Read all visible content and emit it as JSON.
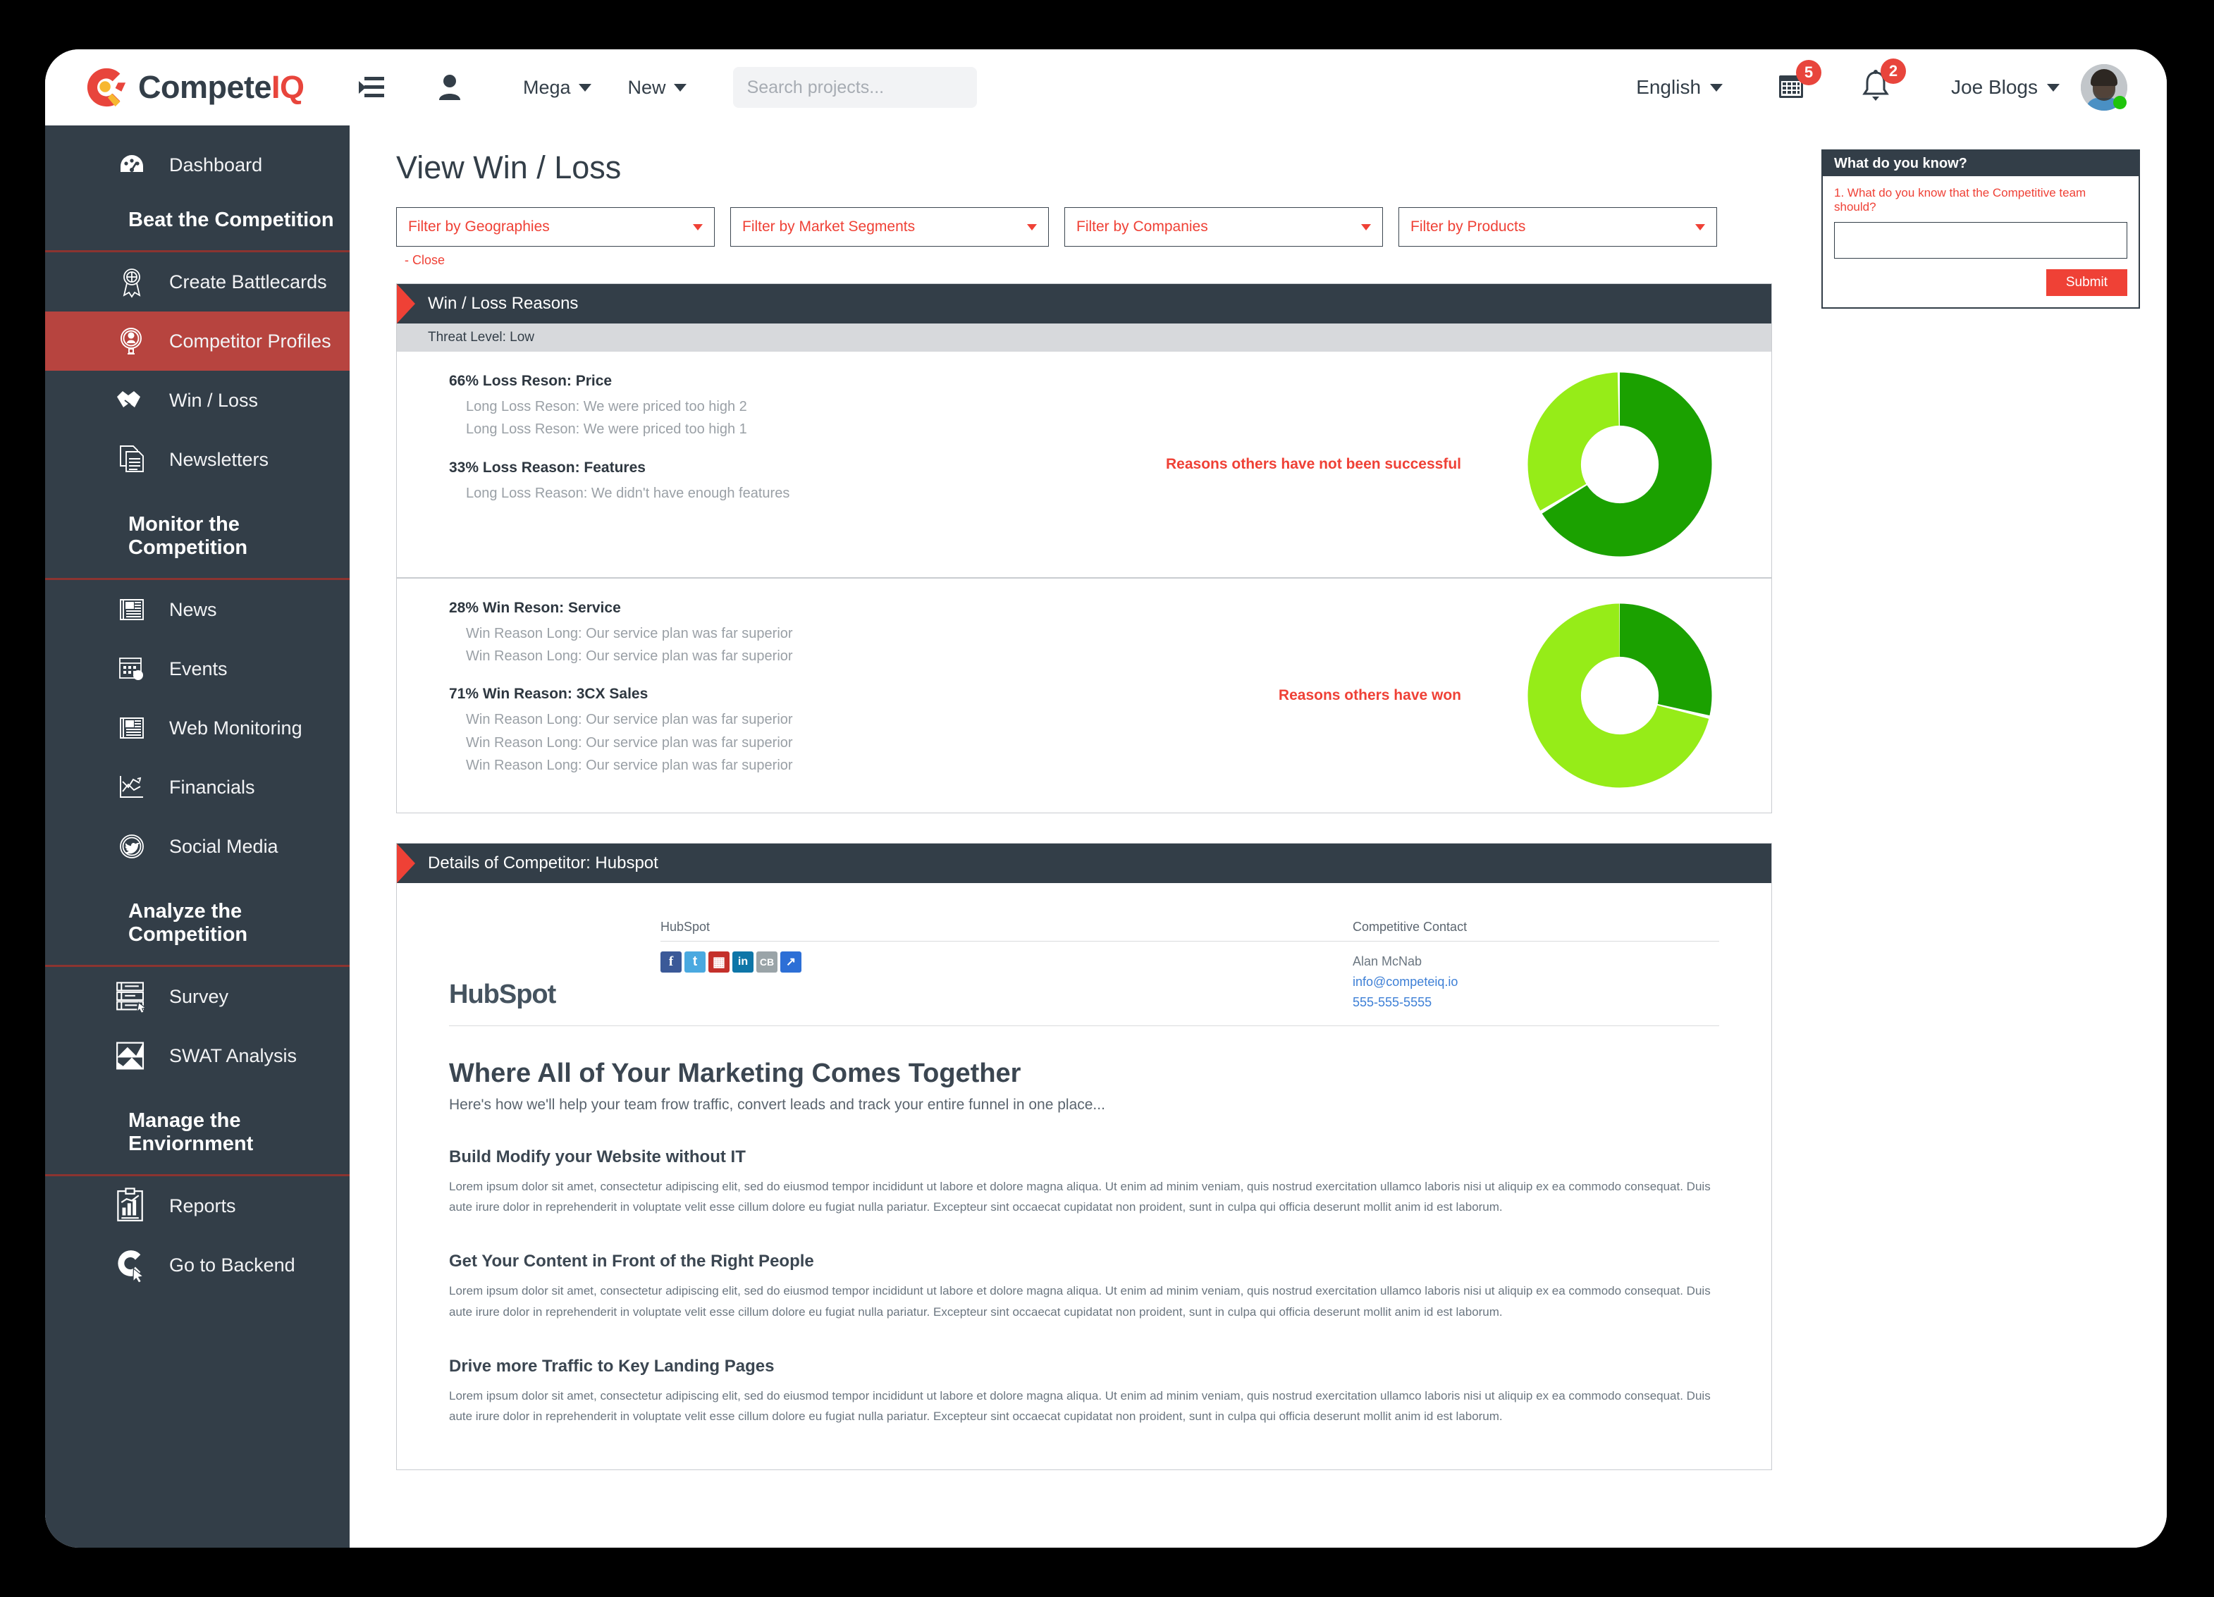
{
  "brand": {
    "name_part_a": "Compete",
    "name_part_b": "IQ",
    "accent": "#ef4136",
    "dark": "#333e48"
  },
  "topbar": {
    "collapse_icon": "collapse-menu-icon",
    "person_icon": "person-icon",
    "menus": [
      {
        "label": "Mega"
      },
      {
        "label": "New"
      }
    ],
    "search": {
      "placeholder": "Search projects...",
      "value": "",
      "icon": "search-icon"
    },
    "language": "English",
    "calendar": {
      "icon": "calendar-icon",
      "badge": "5"
    },
    "notifications": {
      "icon": "bell-icon",
      "badge": "2"
    },
    "user": {
      "name": "Joe Blogs",
      "status": "online"
    }
  },
  "sidebar": {
    "items": [
      {
        "label": "Dashboard",
        "icon": "dashboard-gauge-icon",
        "type": "item",
        "active": false
      },
      {
        "label": "Beat the Competition",
        "type": "group"
      },
      {
        "label": "Create Battlecards",
        "icon": "award-ribbon-icon",
        "type": "item",
        "active": false
      },
      {
        "label": "Competitor Profiles",
        "icon": "profile-magnifier-icon",
        "type": "item",
        "active": true
      },
      {
        "label": "Win / Loss",
        "icon": "handshake-icon",
        "type": "item",
        "active": false
      },
      {
        "label": "Newsletters",
        "icon": "documents-icon",
        "type": "item",
        "active": false
      },
      {
        "label": "Monitor the Competition",
        "type": "group"
      },
      {
        "label": "News",
        "icon": "newspaper-icon",
        "type": "item",
        "active": false
      },
      {
        "label": "Events",
        "icon": "calendar-event-icon",
        "type": "item",
        "active": false
      },
      {
        "label": "Web Monitoring",
        "icon": "newspaper-icon",
        "type": "item",
        "active": false
      },
      {
        "label": "Financials",
        "icon": "chart-lines-icon",
        "type": "item",
        "active": false
      },
      {
        "label": "Social Media",
        "icon": "twitter-bird-icon",
        "type": "item",
        "active": false
      },
      {
        "label": "Analyze the Competition",
        "type": "group"
      },
      {
        "label": "Survey",
        "icon": "survey-list-icon",
        "type": "item",
        "active": false
      },
      {
        "label": "SWAT Analysis",
        "icon": "swat-arrows-icon",
        "type": "item",
        "active": false
      },
      {
        "label": "Manage the Enviornment",
        "type": "group"
      },
      {
        "label": "Reports",
        "icon": "report-clipboard-icon",
        "type": "item",
        "active": false
      },
      {
        "label": "Go to Backend",
        "icon": "backend-cursor-icon",
        "type": "item",
        "active": false
      }
    ]
  },
  "page": {
    "title": "View Win / Loss",
    "close_label": "- Close"
  },
  "filters": [
    {
      "label": "Filter by Geographies"
    },
    {
      "label": "Filter by Market Segments"
    },
    {
      "label": "Filter by Companies"
    },
    {
      "label": "Filter by Products"
    }
  ],
  "winloss": {
    "panel_title": "Win / Loss Reasons",
    "threat_level": "Threat Level: Low",
    "loss": {
      "caption": "Reasons others have not been successful",
      "reasons": [
        {
          "pct": "66%",
          "title": "Loss Reson: Price",
          "details": [
            "Long Loss Reson: We were priced too high 2",
            "Long Loss Reson: We were priced too high 1"
          ]
        },
        {
          "pct": "33%",
          "title": "Loss Reason: Features",
          "details": [
            "Long Loss  Reason: We didn't have enough features"
          ]
        }
      ]
    },
    "win": {
      "caption": "Reasons others have won",
      "reasons": [
        {
          "pct": "28%",
          "title": "Win Reson: Service",
          "details": [
            "Win Reason Long: Our service plan was far superior",
            "Win Reason Long: Our service plan was far superior"
          ]
        },
        {
          "pct": "71%",
          "title": "Win Reason: 3CX Sales",
          "details": [
            "Win Reason Long: Our service plan was far superior",
            "Win Reason Long: Our service plan was far superior",
            "Win Reason Long: Our service plan was far superior"
          ]
        }
      ]
    }
  },
  "chart_data": [
    {
      "type": "pie",
      "title": "Reasons others have not been successful",
      "categories": [
        "Loss Reson: Price",
        "Loss Reason: Features"
      ],
      "values": [
        66,
        33
      ],
      "colors": [
        "#1ba100",
        "#96ec18"
      ],
      "donut": true,
      "legend": "none"
    },
    {
      "type": "pie",
      "title": "Reasons others have won",
      "categories": [
        "Win Reason: 3CX Sales",
        "Win Reson: Service"
      ],
      "values": [
        71,
        28
      ],
      "colors": [
        "#96ec18",
        "#1ba100"
      ],
      "donut": true,
      "legend": "none"
    }
  ],
  "wdyk": {
    "title": "What do you know?",
    "question": "1. What do you know that the Competitive team should?",
    "answer": "",
    "submit_label": "Submit"
  },
  "details": {
    "panel_title": "Details of Competitor: Hubspot",
    "company_logo": "HubSpot",
    "column_company_label": "HubSpot",
    "column_contact_label": "Competitive Contact",
    "social": [
      {
        "name": "facebook-icon",
        "glyph": "f"
      },
      {
        "name": "twitter-icon",
        "glyph": "t"
      },
      {
        "name": "youtube-icon",
        "glyph": "▦"
      },
      {
        "name": "linkedin-icon",
        "glyph": "in"
      },
      {
        "name": "crunchbase-icon",
        "glyph": "CB"
      },
      {
        "name": "external-link-icon",
        "glyph": "↗"
      }
    ],
    "contact": {
      "name": "Alan McNab",
      "email": "info@competeiq.io",
      "phone": "555-555-5555"
    },
    "marketing": {
      "headline": "Where All of Your Marketing Comes Together",
      "subhead": "Here's how we'll help your team frow traffic, convert leads and track your entire funnel in one place...",
      "sections": [
        {
          "heading": "Build Modify your Website without IT",
          "body": "Lorem ipsum dolor sit amet, consectetur adipiscing elit, sed do eiusmod tempor incididunt ut labore et dolore magna aliqua. Ut enim ad minim veniam, quis nostrud exercitation ullamco laboris nisi ut aliquip ex ea commodo consequat. Duis aute irure dolor in reprehenderit in voluptate velit esse cillum dolore eu fugiat nulla pariatur. Excepteur sint occaecat cupidatat non proident, sunt in culpa qui officia deserunt mollit anim id est laborum."
        },
        {
          "heading": "Get Your Content in Front of the Right People",
          "body": "Lorem ipsum dolor sit amet, consectetur adipiscing elit, sed do eiusmod tempor incididunt ut labore et dolore magna aliqua. Ut enim ad minim veniam, quis nostrud exercitation ullamco laboris nisi ut aliquip ex ea commodo consequat. Duis aute irure dolor in reprehenderit in voluptate velit esse cillum dolore eu fugiat nulla pariatur. Excepteur sint occaecat cupidatat non proident, sunt in culpa qui officia deserunt mollit anim id est laborum."
        },
        {
          "heading": "Drive more Traffic to Key Landing Pages",
          "body": "Lorem ipsum dolor sit amet, consectetur adipiscing elit, sed do eiusmod tempor incididunt ut labore et dolore magna aliqua. Ut enim ad minim veniam, quis nostrud exercitation ullamco laboris nisi ut aliquip ex ea commodo consequat. Duis aute irure dolor in reprehenderit in voluptate velit esse cillum dolore eu fugiat nulla pariatur. Excepteur sint occaecat cupidatat non proident, sunt in culpa qui officia deserunt mollit anim id est laborum."
        }
      ]
    }
  }
}
